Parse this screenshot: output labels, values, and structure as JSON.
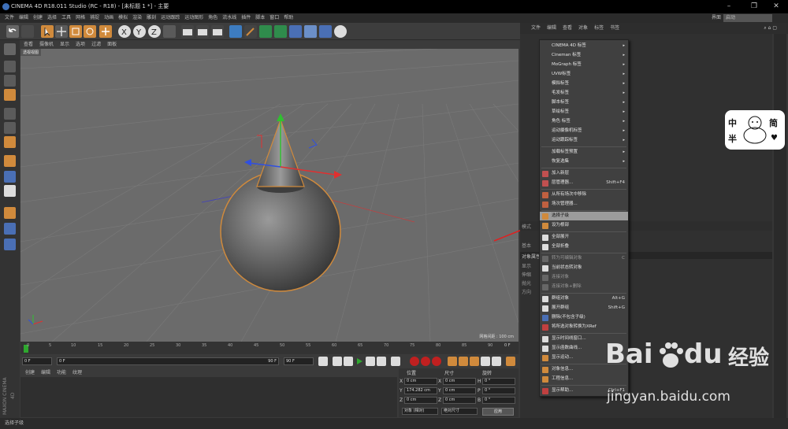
{
  "window": {
    "title": "CINEMA 4D R18.011 Studio (RC - R18) - [未标题 1 *] - 主要",
    "minimize": "–",
    "maximize": "❐",
    "close": "✕"
  },
  "menubar": [
    "文件",
    "编辑",
    "创建",
    "选择",
    "工具",
    "网格",
    "捕捉",
    "动画",
    "模拟",
    "渲染",
    "雕刻",
    "运动跟踪",
    "运动图形",
    "角色",
    "流水线",
    "插件",
    "脚本",
    "窗口",
    "帮助"
  ],
  "layout": {
    "label": "界面",
    "value": "启动"
  },
  "viewport": {
    "menu": [
      "查看",
      "摄像机",
      "显示",
      "选项",
      "过滤",
      "面板"
    ],
    "label": "透视视图",
    "grid_info": "网格间距 : 100 cm"
  },
  "timeline": {
    "ticks": [
      "0",
      "5",
      "10",
      "15",
      "20",
      "25",
      "30",
      "35",
      "40",
      "45",
      "50",
      "55",
      "60",
      "65",
      "70",
      "75",
      "80",
      "85",
      "90"
    ],
    "current_frame": "0 F"
  },
  "playback": {
    "start": "0 F",
    "min": "0 F",
    "max": "90 F",
    "end": "90 F"
  },
  "material_menu": [
    "创建",
    "编辑",
    "功能",
    "纹理"
  ],
  "coords": {
    "headers": [
      "位置",
      "尺寸",
      "旋转"
    ],
    "rows": [
      {
        "axis": "X",
        "pos": "0 cm",
        "size": "0 cm",
        "rot_label": "H",
        "rot": "0 °"
      },
      {
        "axis": "Y",
        "pos": "174.282 cm",
        "size": "0 cm",
        "rot_label": "P",
        "rot": "0 °"
      },
      {
        "axis": "Z",
        "pos": "0 cm",
        "size": "0 cm",
        "rot_label": "B",
        "rot": "0 °"
      }
    ],
    "mode": "对象 (相对)",
    "size_mode": "绝对尺寸",
    "apply": "应用"
  },
  "status": "选择子级",
  "maxon_logo": "MAXON CINEMA 4D",
  "right_panel": {
    "menu": [
      "文件",
      "编辑",
      "查看",
      "对象",
      "标签",
      "书签"
    ],
    "attr_labels": [
      "模式",
      "基本",
      "对象属性",
      "显示",
      "伸缩",
      "抛光",
      "方向"
    ]
  },
  "context_menu": {
    "items": [
      {
        "label": "CINEMA 4D 标签",
        "arrow": "▸"
      },
      {
        "label": "Cineman 标签",
        "arrow": "▸"
      },
      {
        "label": "MoGraph 标签",
        "arrow": "▸"
      },
      {
        "label": "UVW标签",
        "arrow": "▸"
      },
      {
        "label": "模拟标签",
        "arrow": "▸"
      },
      {
        "label": "毛发标签",
        "arrow": "▸"
      },
      {
        "label": "脚本标签",
        "arrow": "▸"
      },
      {
        "label": "草绘标签",
        "arrow": "▸"
      },
      {
        "label": "角色 标签",
        "arrow": "▸"
      },
      {
        "label": "运动摄像机标签",
        "arrow": "▸"
      },
      {
        "label": "运动跟踪标签",
        "arrow": "▸"
      },
      {
        "label": "加载标签预置",
        "arrow": "▸"
      },
      {
        "label": "恢复选集",
        "arrow": "▸"
      },
      {
        "label": "加入新层",
        "shortcut": ""
      },
      {
        "label": "层管理器...",
        "shortcut": "Shift+F4"
      },
      {
        "label": "从所有场次中移除",
        "shortcut": ""
      },
      {
        "label": "场次管理器...",
        "shortcut": ""
      },
      {
        "label": "选择子级",
        "shortcut": ""
      },
      {
        "label": "设为根部",
        "shortcut": ""
      },
      {
        "label": "全部展开",
        "shortcut": ""
      },
      {
        "label": "全部折叠",
        "shortcut": ""
      },
      {
        "label": "转为可编辑对象",
        "shortcut": "C"
      },
      {
        "label": "当前状态转对象",
        "shortcut": ""
      },
      {
        "label": "连接对象",
        "shortcut": ""
      },
      {
        "label": "连接对象+删除",
        "shortcut": ""
      },
      {
        "label": "群组对象",
        "shortcut": "Alt+G"
      },
      {
        "label": "展开群组",
        "shortcut": "Shift+G"
      },
      {
        "label": "删除(不包含子级)",
        "shortcut": ""
      },
      {
        "label": "将所选对象转换为XRef",
        "shortcut": ""
      },
      {
        "label": "显示时间线窗口...",
        "shortcut": ""
      },
      {
        "label": "显示函数曲线...",
        "shortcut": ""
      },
      {
        "label": "显示运动...",
        "shortcut": ""
      },
      {
        "label": "对象信息...",
        "shortcut": ""
      },
      {
        "label": "工程信息...",
        "shortcut": ""
      },
      {
        "label": "显示帮助...",
        "shortcut": "Ctrl+F1"
      }
    ]
  },
  "watermark": {
    "brand": "Bai",
    "brand2": "du",
    "cn": "经验",
    "url": "jingyan.baidu.com"
  },
  "sticker": {
    "left_top": "中",
    "left_bottom": "半",
    "right": "简"
  },
  "colors": {
    "menu_highlight": "#9c9c9c",
    "bg_dark": "#2b2b2b",
    "viewport": "#6b6b6b",
    "selection_orange": "#d08a3c",
    "axis_x": "#e03030",
    "axis_y": "#30c030",
    "axis_z": "#3050e0"
  }
}
